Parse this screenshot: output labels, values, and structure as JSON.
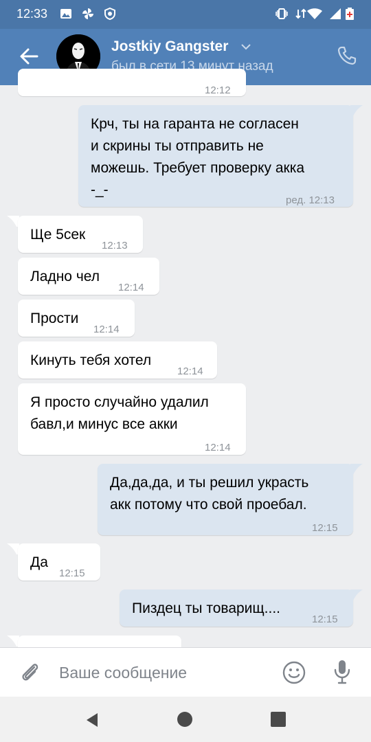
{
  "status_bar": {
    "time": "12:33"
  },
  "header": {
    "title": "Jostkiy Gangster",
    "subtitle": "был в сети 13 минут назад"
  },
  "messages": [
    {
      "direction": "in",
      "text": "",
      "time": "12:12"
    },
    {
      "direction": "out",
      "lines": [
        "Крч, ты на гаранта не согласен",
        "и скрины ты отправить не",
        "можешь. Требует проверку акка",
        "-_-"
      ],
      "time": "ред. 12:13"
    },
    {
      "direction": "in",
      "text": "Ще 5сек",
      "time": "12:13"
    },
    {
      "direction": "in",
      "text": "Ладно чел",
      "time": "12:14"
    },
    {
      "direction": "in",
      "text": "Прости",
      "time": "12:14"
    },
    {
      "direction": "in",
      "text": "Кинуть тебя хотел",
      "time": "12:14"
    },
    {
      "direction": "in",
      "lines": [
        "Я просто случайно удалил",
        "бавл,и минус все акки"
      ],
      "time": "12:14"
    },
    {
      "direction": "out",
      "lines": [
        "Да,да,да, и ты решил украсть",
        "акк потому что свой проебал."
      ],
      "time": "12:15"
    },
    {
      "direction": "in",
      "text": "Да",
      "time": "12:15"
    },
    {
      "direction": "out",
      "text": "Пиздец ты товарищ....",
      "time": "12:15"
    }
  ],
  "composer": {
    "placeholder": "Ваше сообщение"
  },
  "colors": {
    "header": "#5181b8",
    "status_bar": "#4a76a8",
    "outgoing_bubble": "#dbe5f0",
    "incoming_bubble": "#ffffff",
    "background": "#edeef0"
  },
  "icons": {
    "back": "arrow-left-icon",
    "call": "phone-icon",
    "attach": "paperclip-icon",
    "emoji": "smile-icon",
    "voice": "microphone-icon"
  }
}
